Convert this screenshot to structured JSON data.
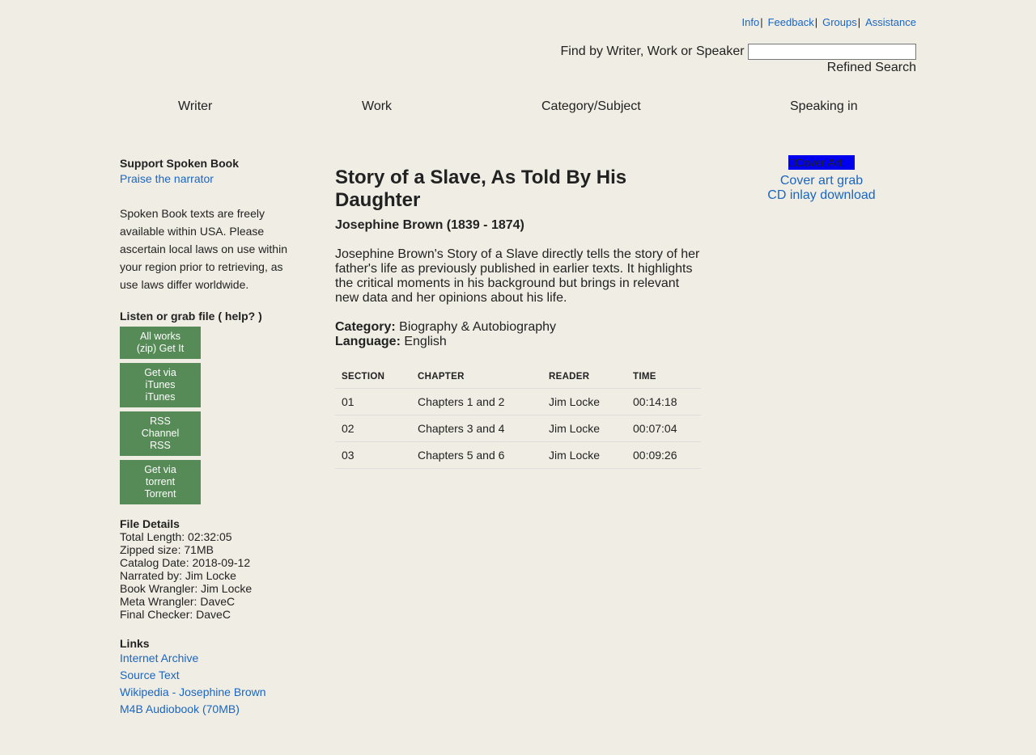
{
  "top_links": [
    "Info",
    "Feedback",
    "Groups",
    "Assistance"
  ],
  "search": {
    "label": "Find by Writer, Work or Speaker",
    "value": "",
    "refined": "Refined Search"
  },
  "nav": [
    "Writer",
    "Work",
    "Category/Subject",
    "Speaking in"
  ],
  "left": {
    "support_heading": "Support Spoken Book",
    "praise_link": "Praise the narrator",
    "support_text": "Spoken Book texts are freely available within USA. Please ascertain local laws on use within your region prior to retrieving, as use laws differ worldwide.",
    "listen_heading": "Listen or grab file ( help? )",
    "buttons": [
      "All works\n(zip) Get It",
      "Get via\niTunes\niTunes",
      "RSS\nChannel\nRSS",
      "Get via\ntorrent\nTorrent"
    ],
    "details_heading": "File Details",
    "details": [
      "Total Length: 02:32:05",
      "Zipped size: 71MB",
      "Catalog Date: 2018-09-12",
      "Narrated by: Jim Locke",
      "Book Wrangler: Jim Locke",
      "Meta Wrangler: DaveC",
      "Final Checker: DaveC"
    ],
    "links_heading": "Links",
    "links": [
      "Internet Archive",
      "Source Text",
      "Wikipedia - Josephine Brown",
      "M4B Audiobook (70MB)"
    ]
  },
  "book": {
    "title": "Story of a Slave, As Told By His Daughter",
    "author": "Josephine Brown (1839 - 1874)",
    "description": "Josephine Brown's Story of a Slave directly tells the story of her father's life as previously published in earlier texts. It highlights the critical moments in his background but brings in relevant new data and her opinions about his life.",
    "category_label": "Category:",
    "category": "Biography & Autobiography",
    "language_label": "Language:",
    "language": "English"
  },
  "table": {
    "headers": [
      "SECTION",
      "CHAPTER",
      "READER",
      "TIME"
    ],
    "rows": [
      [
        "01",
        "Chapters 1 and 2",
        "Jim Locke",
        "00:14:18"
      ],
      [
        "02",
        "Chapters 3 and 4",
        "Jim Locke",
        "00:07:04"
      ],
      [
        "03",
        "Chapters 5 and 6",
        "Jim Locke",
        "00:09:26"
      ]
    ]
  },
  "right": {
    "cover_alt": "Cover Art",
    "cover_grab": "Cover art grab",
    "cd_inlay": "CD inlay download"
  },
  "colors": {
    "background": "#f0ede4",
    "link": "#1a66c2",
    "button": "#568a57"
  }
}
